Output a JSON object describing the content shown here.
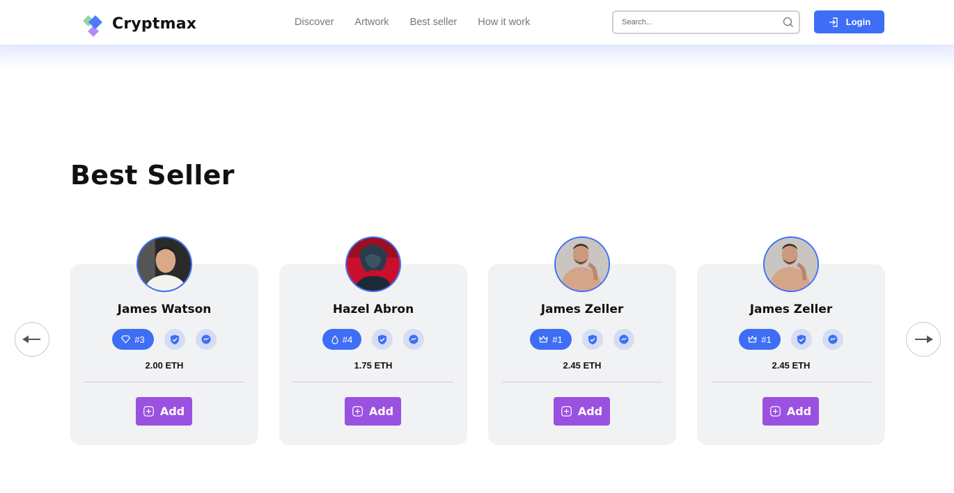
{
  "header": {
    "brand": "Cryptmax",
    "nav": [
      "Discover",
      "Artwork",
      "Best seller",
      "How it work"
    ],
    "search_placeholder": "Search...",
    "login_label": "Login"
  },
  "section": {
    "title": "Best Seller"
  },
  "cards": [
    {
      "name": "James Watson",
      "rank_icon": "diamond-icon",
      "rank": "#3",
      "price": "2.00 ETH",
      "add_label": "Add",
      "avatar": "man-portrait-white-shirt"
    },
    {
      "name": "Hazel Abron",
      "rank_icon": "drop-icon",
      "rank": "#4",
      "price": "1.75 ETH",
      "add_label": "Add",
      "avatar": "person-red-light"
    },
    {
      "name": "James Zeller",
      "rank_icon": "crown-icon",
      "rank": "#1",
      "price": "2.45 ETH",
      "add_label": "Add",
      "avatar": "shirtless-man"
    },
    {
      "name": "James Zeller",
      "rank_icon": "crown-icon",
      "rank": "#1",
      "price": "2.45 ETH",
      "add_label": "Add",
      "avatar": "shirtless-man"
    }
  ],
  "colors": {
    "primary": "#3d6ef5",
    "add_button": "#9b51e0",
    "card_bg": "#f1f2f4",
    "badge_bg": "#d5ddf4"
  }
}
